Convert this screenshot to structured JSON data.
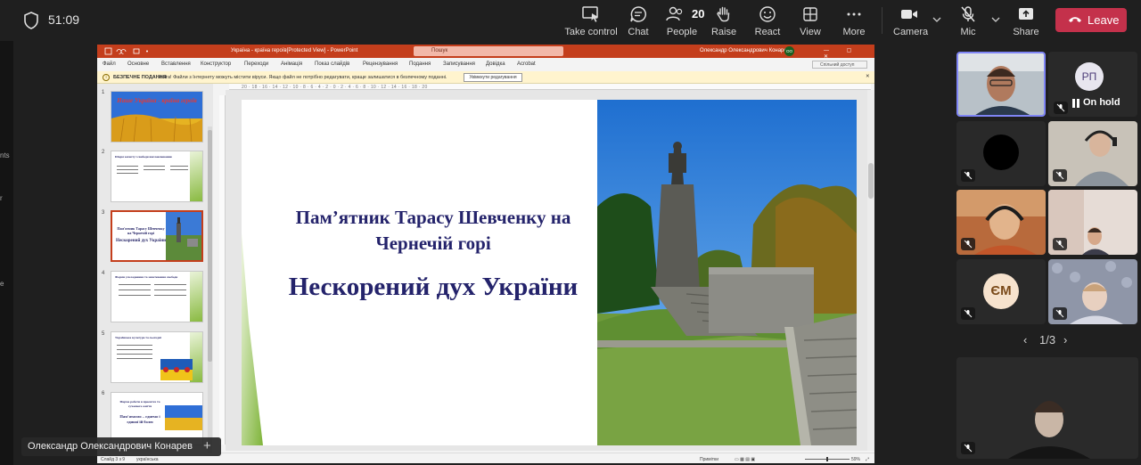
{
  "meeting": {
    "timer": "51:09",
    "people_count": "20",
    "toolbar": {
      "take_control": "Take control",
      "chat": "Chat",
      "people": "People",
      "raise": "Raise",
      "react": "React",
      "view": "View",
      "more": "More",
      "camera": "Camera",
      "mic": "Mic",
      "share": "Share",
      "leave": "Leave"
    },
    "left_strip_texts": [
      "nts",
      "r",
      "e"
    ],
    "presenter_name": "Олександр Олександрович Конарев",
    "pager": {
      "prev": "‹",
      "label": "1/3",
      "next": "›"
    },
    "participants": [
      {
        "id": "p1",
        "type": "video",
        "active": true,
        "muted": false
      },
      {
        "id": "p2",
        "type": "avatar",
        "initials": "РП",
        "status": "On hold",
        "muted": false
      },
      {
        "id": "p3",
        "type": "video",
        "muted": true
      },
      {
        "id": "p4",
        "type": "video",
        "muted": true
      },
      {
        "id": "p5",
        "type": "video",
        "muted": true
      },
      {
        "id": "p6",
        "type": "video",
        "muted": true
      },
      {
        "id": "p7",
        "type": "avatar",
        "initials": "ЄМ",
        "muted": true
      },
      {
        "id": "p8",
        "type": "video",
        "muted": true
      },
      {
        "id": "self",
        "type": "video",
        "muted": true
      }
    ],
    "colors": {
      "leave": "#c4314b",
      "active_border": "#7f85f5",
      "ppt_accent": "#c43e1c"
    }
  },
  "powerpoint": {
    "window_title": "Україна - країна героїв[Protected View] - PowerPoint",
    "search_placeholder": "Пошук",
    "user_name": "Олександр Олександрович Конарев",
    "user_initials": "ОО",
    "window_controls": "— ▢ ✕",
    "menu": [
      "Файл",
      "Основне",
      "Вставлення",
      "Конструктор",
      "Переходи",
      "Анімація",
      "Показ слайдів",
      "Рецензування",
      "Подання",
      "Записування",
      "Довідка",
      "Acrobat"
    ],
    "share_button": "Спільний доступ",
    "warning": {
      "heading": "БЕЗПЕЧНЕ ПОДАННЯ",
      "message": "Увага! Файли з Інтернету можуть містити віруси. Якщо файл не потрібно редагувати, краще залишатися в безпечному поданні.",
      "button": "Увімкнути редагування",
      "close": "✕"
    },
    "ruler_label": "20 · 18 · 16 · 14 · 12 · 10 · 8 · 6 · 4 · 2 · 0 · 2 · 4 · 6 · 8 · 10 · 12 · 14 · 16 · 18 · 20",
    "thumbnails": [
      {
        "num": "1",
        "caption": "Наше Україна - країна героїв"
      },
      {
        "num": "2",
        "caption": "Шарм захисту і свободи висловлювання"
      },
      {
        "num": "3",
        "caption": "Пам'ятник Тарасу Шевченку на Чернечій горі",
        "caption2": "Нескорений дух України",
        "selected": true
      },
      {
        "num": "4",
        "caption": "Форми ускладнення та запотевання свободи"
      },
      {
        "num": "5",
        "caption": "Українська культура та сьогодні"
      },
      {
        "num": "6",
        "caption": "Форма роботи в проектах та сучасного життя",
        "caption2": "Пам'ятаємо – єднемо і єдиної їй болю"
      }
    ],
    "slide": {
      "title": "Пам’ятник Тарасу Шевченку на Чернечій горі",
      "subtitle": "Нескорений дух України"
    },
    "status": {
      "slide": "Слайд 3 з 9",
      "language": "українська",
      "notes": "Примітки",
      "zoom": "59%"
    }
  }
}
